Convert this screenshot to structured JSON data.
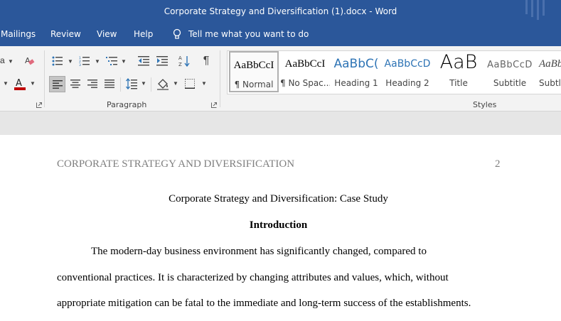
{
  "window": {
    "title": "Corporate Strategy and Diversification (1).docx  -  Word"
  },
  "menu": {
    "items": [
      "Mailings",
      "Review",
      "View",
      "Help"
    ],
    "tell_me": "Tell me what you want to do"
  },
  "ribbon": {
    "paragraph_group": "Paragraph",
    "styles_group": "Styles",
    "font_name_fragment": "a",
    "styles": [
      {
        "sample": "AaBbCcI",
        "name": "¶ Normal"
      },
      {
        "sample": "AaBbCcI",
        "name": "¶ No Spac..."
      },
      {
        "sample": "AaBbC(",
        "name": "Heading 1"
      },
      {
        "sample": "AaBbCcD",
        "name": "Heading 2"
      },
      {
        "sample": "AaB",
        "name": "Title"
      },
      {
        "sample": "AaBbCcD",
        "name": "Subtitle"
      },
      {
        "sample": "AaBbL",
        "name": "Subtle"
      }
    ]
  },
  "document": {
    "header_left": "CORPORATE STRATEGY AND DIVERSIFICATION",
    "header_page": "2",
    "title": "Corporate Strategy and Diversification: Case Study",
    "heading": "Introduction",
    "lines": [
      "The modern-day business environment has significantly changed, compared to",
      "conventional practices. It is characterized by changing attributes and values, which, without",
      "appropriate mitigation can be fatal to the immediate and long-term success of the establishments."
    ]
  },
  "colors": {
    "word_blue": "#2b579a",
    "font_red": "#c00000",
    "heading_blue": "#2e74b5"
  }
}
